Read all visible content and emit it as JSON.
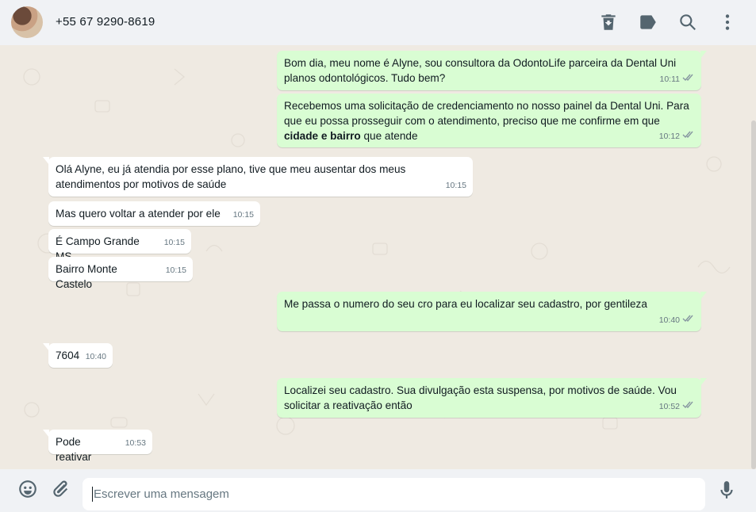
{
  "header": {
    "contact_name": "+55 67 9290-8619",
    "icons": [
      "archive-icon",
      "label-icon",
      "search-icon",
      "menu-icon"
    ]
  },
  "messages": [
    {
      "dir": "out",
      "parts": [
        {
          "t": "Bom dia, meu nome é Alyne, sou consultora da OdontoLife parceira da Dental Uni planos odontológicos. Tudo bem?"
        }
      ],
      "time": "10:11",
      "read": true
    },
    {
      "dir": "out",
      "parts": [
        {
          "t": "Recebemos uma solicitação de credenciamento no nosso painel da Dental Uni. Para que eu possa prosseguir com o atendimento, preciso que me confirme em que "
        },
        {
          "t": "cidade e bairro",
          "b": true
        },
        {
          "t": " que atende"
        }
      ],
      "time": "10:12",
      "read": true
    },
    {
      "dir": "in",
      "parts": [
        {
          "t": "Olá Alyne, eu já atendia por esse plano, tive que meu ausentar dos meus atendimentos por motivos de saúde"
        }
      ],
      "time": "10:15"
    },
    {
      "dir": "in",
      "parts": [
        {
          "t": "Mas quero voltar a atender por ele"
        }
      ],
      "time": "10:15"
    },
    {
      "dir": "in",
      "parts": [
        {
          "t": "É Campo Grande MS"
        }
      ],
      "time": "10:15"
    },
    {
      "dir": "in",
      "parts": [
        {
          "t": "Bairro Monte Castelo"
        }
      ],
      "time": "10:15"
    },
    {
      "dir": "out",
      "parts": [
        {
          "t": "Me passa o numero do seu cro para eu localizar seu cadastro, por gentileza"
        }
      ],
      "time": "10:40",
      "read": true
    },
    {
      "dir": "in",
      "parts": [
        {
          "t": "7604"
        }
      ],
      "time": "10:40"
    },
    {
      "dir": "out",
      "parts": [
        {
          "t": "Localizei seu cadastro. Sua divulgação esta suspensa, por motivos de saúde. Vou solicitar a reativação então"
        }
      ],
      "time": "10:52",
      "read": true
    },
    {
      "dir": "in",
      "parts": [
        {
          "t": "Pode reativar"
        }
      ],
      "time": "10:53"
    }
  ],
  "composer": {
    "placeholder": "Escrever uma mensagem"
  },
  "colors": {
    "outgoing": "#d9fdd3",
    "incoming": "#ffffff",
    "background": "#efeae2",
    "bar": "#f0f2f5"
  }
}
